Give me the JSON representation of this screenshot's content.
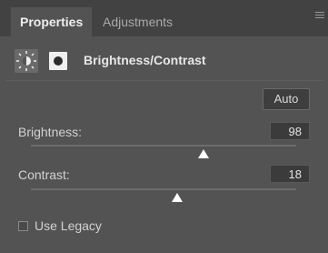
{
  "tabs": [
    {
      "label": "Properties",
      "active": true
    },
    {
      "label": "Adjustments",
      "active": false
    }
  ],
  "panel_menu_icon": "hamburger-icon",
  "header": {
    "icon1": "brightness-contrast-icon",
    "icon2": "layer-mask-icon",
    "title": "Brightness/Contrast"
  },
  "auto_button": {
    "label": "Auto"
  },
  "brightness": {
    "label": "Brightness:",
    "value": "98",
    "slider_level": 0.65
  },
  "contrast": {
    "label": "Contrast:",
    "value": "18",
    "slider_level": 0.55
  },
  "legacy": {
    "label": "Use Legacy",
    "checked": false
  },
  "colors": {
    "panel": "#535353",
    "tabbar": "#424242",
    "field": "#3b3b3b"
  }
}
